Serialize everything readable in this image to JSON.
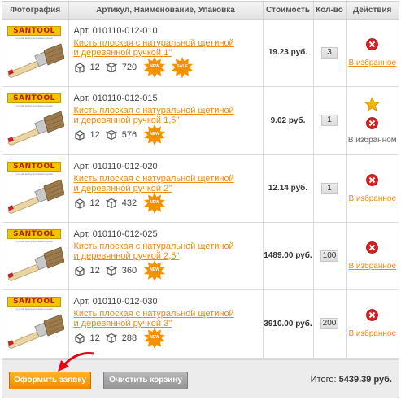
{
  "headers": {
    "photo": "Фотография",
    "name": "Артикул, Наименование, Упаковка",
    "price": "Стоимость",
    "qty": "Кол-во",
    "actions": "Действия"
  },
  "brand_logo": "SANTOOL",
  "brand_logo_sub": "лучший выбор для вашего дома",
  "badges": {
    "new": "NEW",
    "sale": "SALE"
  },
  "items": [
    {
      "article": "Арт. 010110-012-010",
      "name": "Кисть плоская с натуральной щетиной и деревянной ручкой 1\"",
      "pack_small": "12",
      "pack_big": "720",
      "badges": [
        "new",
        "sale"
      ],
      "price": "19.23 руб.",
      "qty": "3",
      "favorite_link": "В избранное",
      "in_favorites": false
    },
    {
      "article": "Арт. 010110-012-015",
      "name": "Кисть плоская с натуральной щетиной и деревянной ручкой 1,5\"",
      "pack_small": "12",
      "pack_big": "576",
      "badges": [
        "new"
      ],
      "price": "9.02 руб.",
      "qty": "1",
      "favorite_link": "В избранном",
      "in_favorites": true
    },
    {
      "article": "Арт. 010110-012-020",
      "name": "Кисть плоская с натуральной щетиной и деревянной ручкой 2\"",
      "pack_small": "12",
      "pack_big": "432",
      "badges": [
        "new"
      ],
      "price": "12.14 руб.",
      "qty": "1",
      "favorite_link": "В избранное",
      "in_favorites": false
    },
    {
      "article": "Арт. 010110-012-025",
      "name": "Кисть плоская с натуральной щетиной и деревянной ручкой 2,5\"",
      "pack_small": "12",
      "pack_big": "360",
      "badges": [
        "new"
      ],
      "price": "1489.00 руб.",
      "qty": "100",
      "favorite_link": "В избранное",
      "in_favorites": false
    },
    {
      "article": "Арт. 010110-012-030",
      "name": "Кисть плоская с натуральной щетиной и деревянной ручкой 3\"",
      "pack_small": "12",
      "pack_big": "288",
      "badges": [
        "new"
      ],
      "price": "3910.00 руб.",
      "qty": "200",
      "favorite_link": "В избранное",
      "in_favorites": false
    }
  ],
  "footer": {
    "order_button": "Оформить заявку",
    "clear_button": "Очистить корзину",
    "total_label": "Итого:",
    "total_value": "5439.39 руб."
  },
  "icons": {
    "small_pack": "small-package-icon",
    "big_pack": "box-package-icon",
    "remove": "remove-icon",
    "favorite": "star-icon",
    "pointer": "arrow-icon"
  },
  "colors": {
    "accent": "#ec8a14",
    "order_button": "#f39a10",
    "clear_button": "#a3a3a3",
    "remove": "#d81e1e",
    "star": "#f5b400"
  }
}
